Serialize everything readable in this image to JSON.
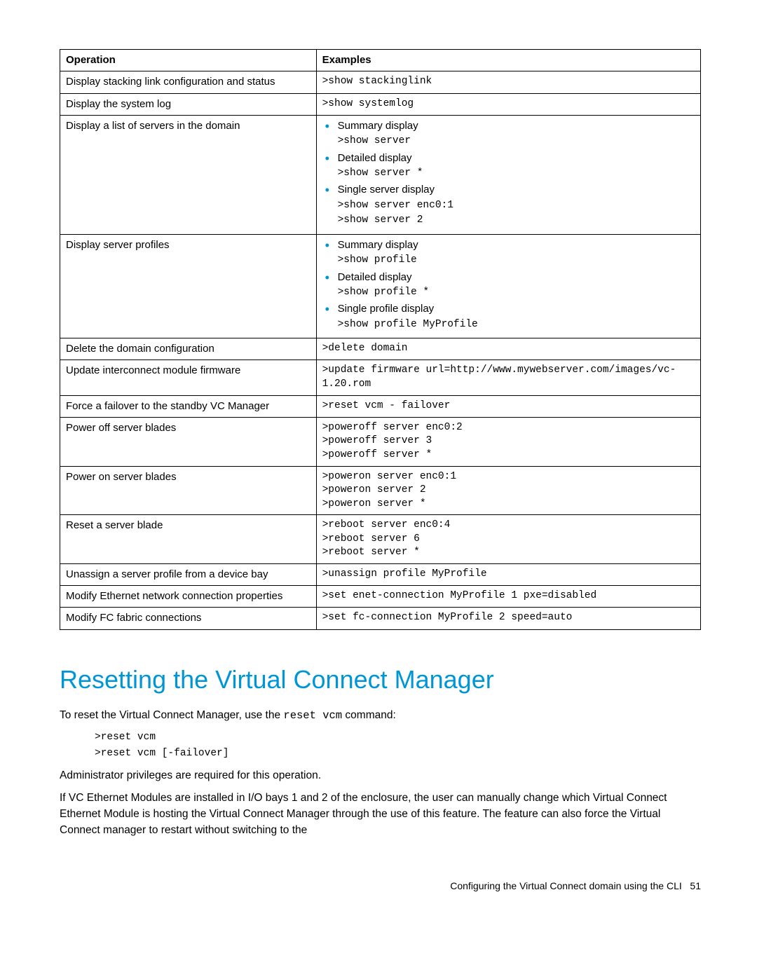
{
  "table": {
    "headers": {
      "operation": "Operation",
      "examples": "Examples"
    },
    "rows": [
      {
        "operation": "Display stacking link configuration and status",
        "code": [
          ">show stackinglink"
        ]
      },
      {
        "operation": "Display the system log",
        "code": [
          ">show systemlog"
        ]
      },
      {
        "operation": "Display a list of servers in the domain",
        "bullets": [
          {
            "label": "Summary display",
            "code": [
              ">show server"
            ]
          },
          {
            "label": "Detailed display",
            "code": [
              ">show server *"
            ]
          },
          {
            "label": "Single server display",
            "code": [
              ">show server enc0:1",
              ">show server 2"
            ]
          }
        ]
      },
      {
        "operation": "Display server profiles",
        "bullets": [
          {
            "label": "Summary display",
            "code": [
              ">show profile"
            ]
          },
          {
            "label": "Detailed display",
            "code": [
              ">show profile *"
            ]
          },
          {
            "label": "Single profile display",
            "code": [
              ">show profile MyProfile"
            ]
          }
        ]
      },
      {
        "operation": "Delete the domain configuration",
        "code": [
          ">delete domain"
        ]
      },
      {
        "operation": "Update interconnect module firmware",
        "code": [
          ">update firmware url=http://www.mywebserver.com/images/vc-1.20.rom"
        ]
      },
      {
        "operation": "Force a failover to the standby VC Manager",
        "code": [
          ">reset vcm - failover"
        ]
      },
      {
        "operation": "Power off server blades",
        "code": [
          ">poweroff server enc0:2",
          ">poweroff server 3",
          ">poweroff server *"
        ]
      },
      {
        "operation": "Power on server blades",
        "code": [
          ">poweron server enc0:1",
          ">poweron server 2",
          ">poweron server *"
        ]
      },
      {
        "operation": "Reset a server blade",
        "code": [
          ">reboot server enc0:4",
          ">reboot server 6",
          ">reboot server *"
        ]
      },
      {
        "operation": "Unassign a server profile from a device bay",
        "code": [
          ">unassign profile MyProfile"
        ]
      },
      {
        "operation": "Modify Ethernet network connection properties",
        "code": [
          ">set enet-connection MyProfile 1 pxe=disabled"
        ]
      },
      {
        "operation": "Modify FC fabric connections",
        "code": [
          ">set fc-connection MyProfile 2 speed=auto"
        ]
      }
    ]
  },
  "section": {
    "heading": "Resetting the Virtual Connect Manager",
    "intro_a": "To reset the Virtual Connect Manager, use the ",
    "intro_cmd": "reset vcm",
    "intro_b": " command:",
    "code": [
      ">reset vcm",
      ">reset vcm [-failover]"
    ],
    "para2": "Administrator privileges are required for this operation.",
    "para3": "If VC Ethernet Modules are installed in I/O bays 1 and 2 of the enclosure, the user can manually change which Virtual Connect Ethernet Module is hosting the Virtual Connect Manager through the use of this feature. The feature can also force the Virtual Connect manager to restart without switching to the"
  },
  "footer": {
    "text": "Configuring the Virtual Connect domain using the CLI",
    "page": "51"
  }
}
